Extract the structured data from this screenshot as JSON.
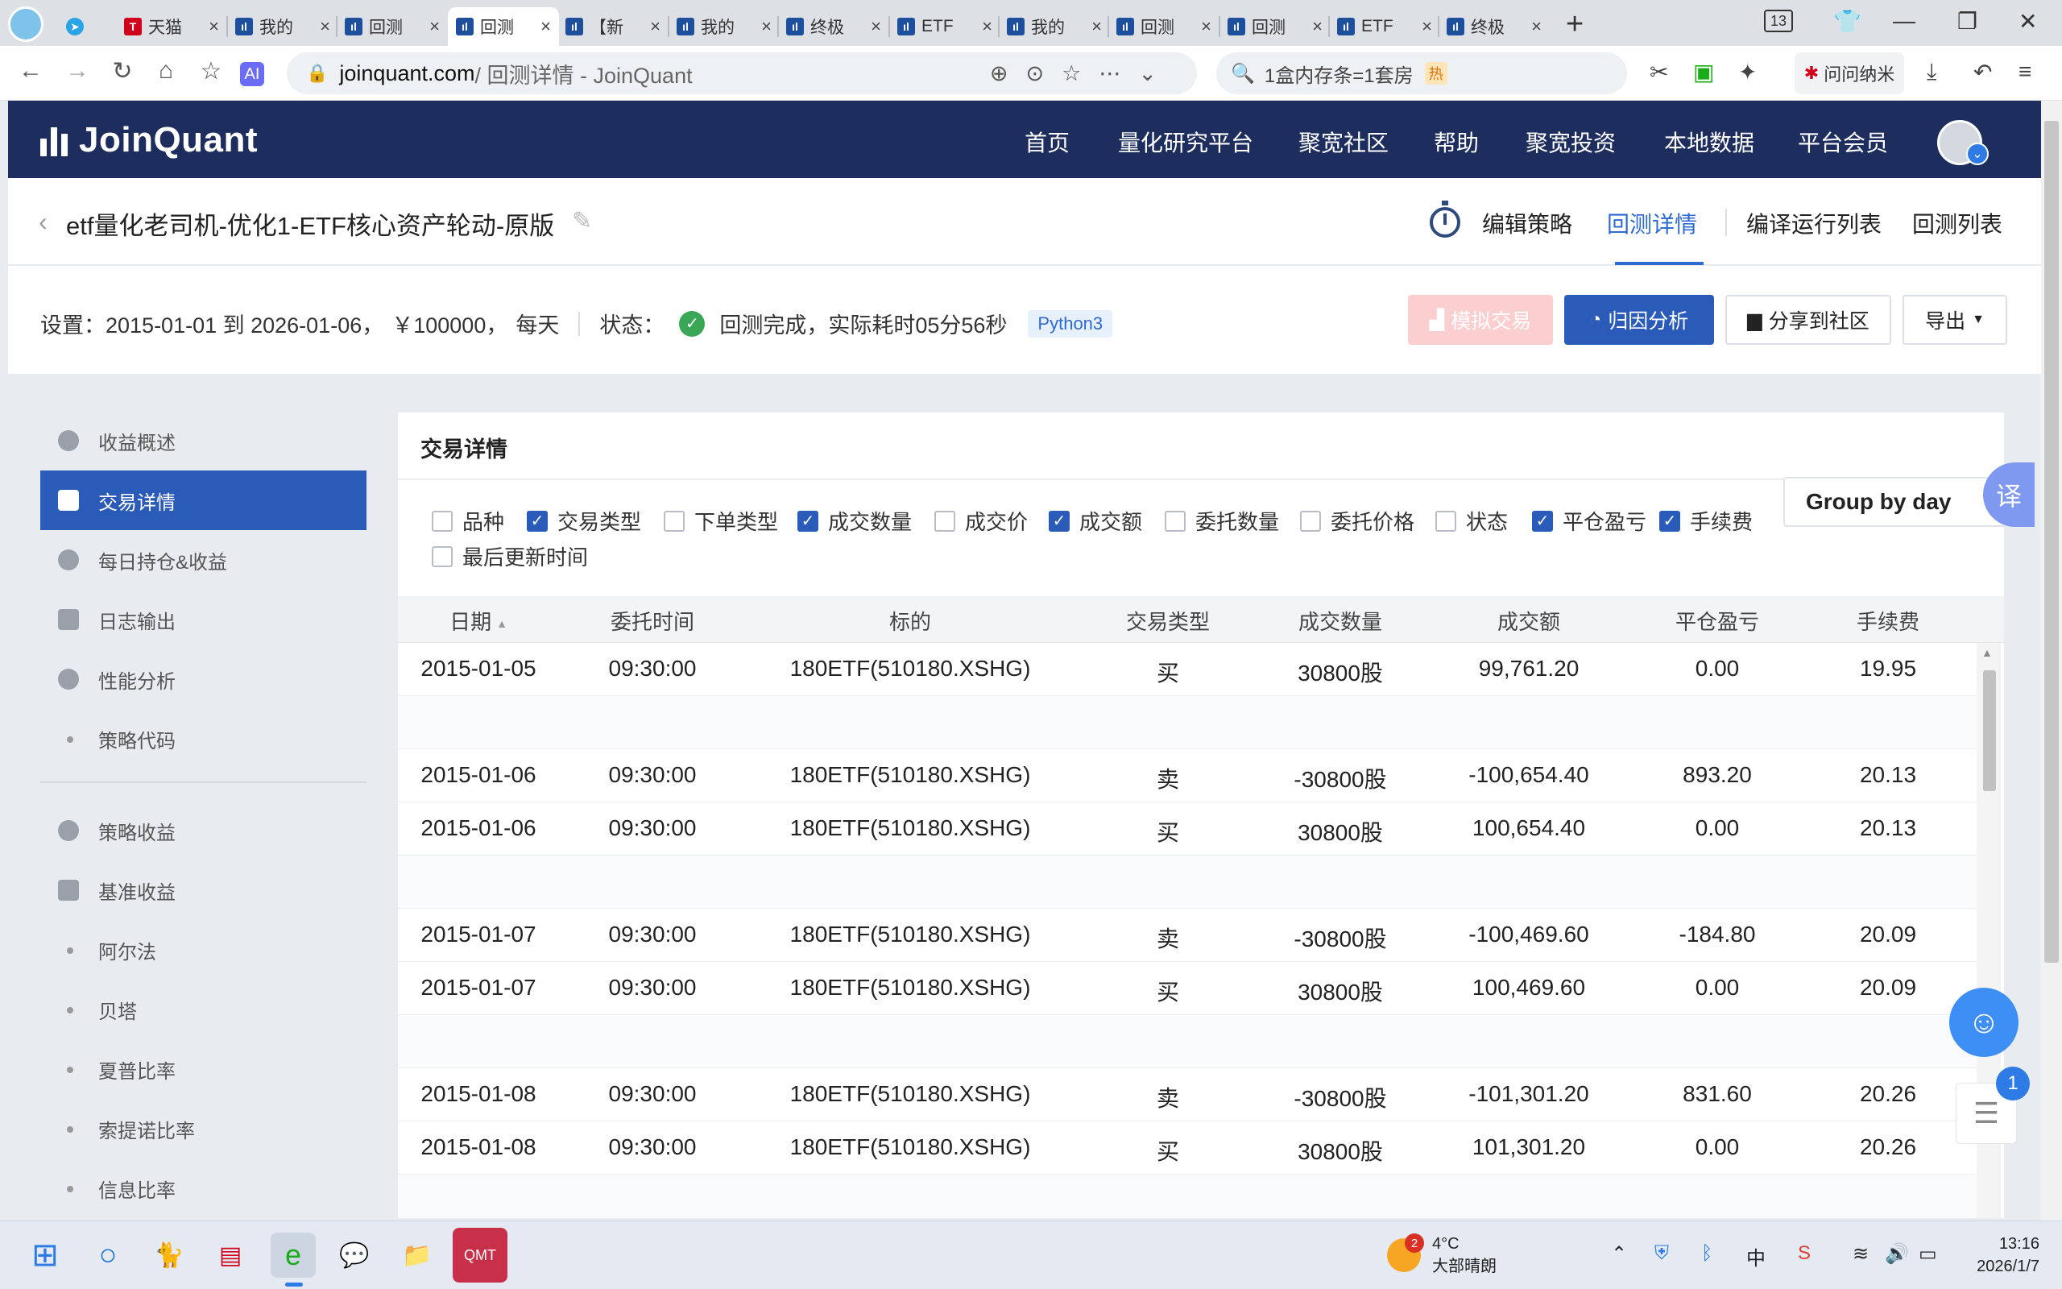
{
  "browser": {
    "tabs": [
      {
        "title": "天猫",
        "icon": "tmall-icon"
      },
      {
        "title": "我的",
        "icon": "joinquant-icon"
      },
      {
        "title": "回测",
        "icon": "joinquant-icon"
      },
      {
        "title": "回测",
        "icon": "joinquant-icon",
        "active": true
      },
      {
        "title": "【新",
        "icon": "joinquant-icon"
      },
      {
        "title": "我的",
        "icon": "joinquant-icon"
      },
      {
        "title": "终极",
        "icon": "joinquant-icon"
      },
      {
        "title": "ETF",
        "icon": "joinquant-icon"
      },
      {
        "title": "我的",
        "icon": "joinquant-icon"
      },
      {
        "title": "回测",
        "icon": "joinquant-icon"
      },
      {
        "title": "回测",
        "icon": "joinquant-icon"
      },
      {
        "title": "ETF",
        "icon": "joinquant-icon"
      },
      {
        "title": "终极",
        "icon": "joinquant-icon"
      }
    ],
    "tab_count": "13",
    "url_host": "joinquant.com",
    "url_rest": " / 回测详情 - JoinQuant",
    "search_text": "1盒内存条=1套房",
    "search_hot": "热",
    "ask_label": "问问纳米"
  },
  "site": {
    "logo_text": "JoinQuant",
    "nav": [
      "首页",
      "量化研究平台",
      "聚宽社区",
      "帮助",
      "聚宽投资",
      "本地数据",
      "平台会员"
    ]
  },
  "header": {
    "title": "etf量化老司机-优化1-ETF核心资产轮动-原版",
    "tabs": [
      "编辑策略",
      "回测详情",
      "编译运行列表",
      "回测列表"
    ],
    "active_tab": "回测详情"
  },
  "settings": {
    "label": "设置：",
    "range": "2015-01-01 到 2026-01-06，",
    "capital": "￥100000，",
    "freq": "每天",
    "status_label": "状态：",
    "status_text": "回测完成，实际耗时05分56秒",
    "lang": "Python3",
    "buttons": {
      "simulate": "模拟交易",
      "attribution": "归因分析",
      "share": "分享到社区",
      "export": "导出"
    }
  },
  "sidebar": {
    "items": [
      {
        "label": "收益概述",
        "icon": "overview-icon"
      },
      {
        "label": "交易详情",
        "icon": "document-icon",
        "active": true
      },
      {
        "label": "每日持仓&收益",
        "icon": "bar-chart-icon"
      },
      {
        "label": "日志输出",
        "icon": "log-icon"
      },
      {
        "label": "性能分析",
        "icon": "pie-icon"
      },
      {
        "label": "策略代码",
        "icon": "dot"
      }
    ],
    "items2": [
      {
        "label": "策略收益",
        "icon": "bulb-icon"
      },
      {
        "label": "基准收益",
        "icon": "database-icon"
      },
      {
        "label": "阿尔法",
        "icon": "dot"
      },
      {
        "label": "贝塔",
        "icon": "dot"
      },
      {
        "label": "夏普比率",
        "icon": "dot"
      },
      {
        "label": "索提诺比率",
        "icon": "dot"
      },
      {
        "label": "信息比率",
        "icon": "dot"
      }
    ]
  },
  "panel": {
    "title": "交易详情",
    "group_label": "Group by day",
    "checkboxes": [
      {
        "label": "品种",
        "checked": false
      },
      {
        "label": "交易类型",
        "checked": true
      },
      {
        "label": "下单类型",
        "checked": false
      },
      {
        "label": "成交数量",
        "checked": true
      },
      {
        "label": "成交价",
        "checked": false
      },
      {
        "label": "成交额",
        "checked": true
      },
      {
        "label": "委托数量",
        "checked": false
      },
      {
        "label": "委托价格",
        "checked": false
      },
      {
        "label": "状态",
        "checked": false
      },
      {
        "label": "平仓盈亏",
        "checked": true
      },
      {
        "label": "手续费",
        "checked": true
      },
      {
        "label": "最后更新时间",
        "checked": false
      }
    ],
    "columns": [
      "日期",
      "委托时间",
      "标的",
      "交易类型",
      "成交数量",
      "成交额",
      "平仓盈亏",
      "手续费"
    ],
    "rows": [
      [
        "2015-01-05",
        "09:30:00",
        "180ETF(510180.XSHG)",
        "买",
        "30800股",
        "99,761.20",
        "0.00",
        "19.95"
      ],
      null,
      [
        "2015-01-06",
        "09:30:00",
        "180ETF(510180.XSHG)",
        "卖",
        "-30800股",
        "-100,654.40",
        "893.20",
        "20.13"
      ],
      [
        "2015-01-06",
        "09:30:00",
        "180ETF(510180.XSHG)",
        "买",
        "30800股",
        "100,654.40",
        "0.00",
        "20.13"
      ],
      null,
      [
        "2015-01-07",
        "09:30:00",
        "180ETF(510180.XSHG)",
        "卖",
        "-30800股",
        "-100,469.60",
        "-184.80",
        "20.09"
      ],
      [
        "2015-01-07",
        "09:30:00",
        "180ETF(510180.XSHG)",
        "买",
        "30800股",
        "100,469.60",
        "0.00",
        "20.09"
      ],
      null,
      [
        "2015-01-08",
        "09:30:00",
        "180ETF(510180.XSHG)",
        "卖",
        "-30800股",
        "-101,301.20",
        "831.60",
        "20.26"
      ],
      [
        "2015-01-08",
        "09:30:00",
        "180ETF(510180.XSHG)",
        "买",
        "30800股",
        "101,301.20",
        "0.00",
        "20.26"
      ],
      null
    ],
    "translate_label": "译",
    "list_badge": "1"
  },
  "taskbar": {
    "weather_temp": "4°C",
    "weather_desc": "大部晴朗",
    "weather_badge": "2",
    "ime": "中",
    "time": "13:16",
    "date": "2026/1/7"
  }
}
